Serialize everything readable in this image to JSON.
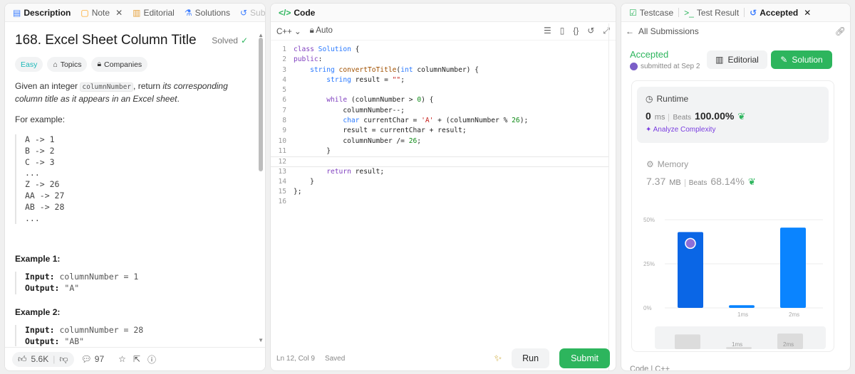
{
  "left": {
    "tabs": [
      {
        "label": "Description",
        "icon": "doc-icon"
      },
      {
        "label": "Note",
        "icon": "note-icon"
      },
      {
        "label": "Editorial",
        "icon": "book-icon"
      },
      {
        "label": "Solutions",
        "icon": "flask-icon"
      },
      {
        "label": "Sub",
        "icon": "history-icon"
      }
    ],
    "title": "168. Excel Sheet Column Title",
    "solved": "Solved",
    "tags": {
      "easy": "Easy",
      "topics": "Topics",
      "companies": "Companies"
    },
    "intro": {
      "a": "Given an integer ",
      "code": "columnNumber",
      "b": ", return ",
      "c": "its corresponding column title as it appears in an Excel sheet",
      "d": "."
    },
    "for_example": "For example:",
    "mapping": [
      "A -> 1",
      "B -> 2",
      "C -> 3",
      "...",
      "Z -> 26",
      "AA -> 27",
      "AB -> 28",
      "..."
    ],
    "example1": {
      "title": "Example 1:",
      "input_label": "Input:",
      "input": " columnNumber = 1",
      "output_label": "Output:",
      "output": " \"A\""
    },
    "example2": {
      "title": "Example 2:",
      "input_label": "Input:",
      "input": " columnNumber = 28",
      "output_label": "Output:",
      "output": " \"AB\""
    },
    "footer": {
      "likes": "5.6K",
      "comments": "97"
    }
  },
  "mid": {
    "tab": "Code",
    "lang": "C++",
    "mode": "Auto",
    "status": {
      "pos": "Ln 12, Col 9",
      "saved": "Saved"
    },
    "run": "Run",
    "submit": "Submit",
    "lines": [
      "class Solution {",
      "public:",
      "    string convertToTitle(int columnNumber) {",
      "        string result = \"\";",
      "",
      "        while (columnNumber > 0) {",
      "            columnNumber--;",
      "            char currentChar = 'A' + (columnNumber % 26);",
      "            result = currentChar + result;",
      "            columnNumber /= 26;",
      "        }",
      "",
      "        return result;",
      "    }",
      "};",
      ""
    ]
  },
  "right": {
    "tabs": [
      {
        "label": "Testcase",
        "icon": "check-box-icon"
      },
      {
        "label": "Test Result",
        "icon": "terminal-icon"
      },
      {
        "label": "Accepted",
        "icon": "history-icon"
      }
    ],
    "back": "All Submissions",
    "status": "Accepted",
    "submitted": "submitted at Sep 2",
    "editorial_btn": "Editorial",
    "solution_btn": "Solution",
    "runtime": {
      "label": "Runtime",
      "value": "0",
      "unit": "ms",
      "beats_label": "Beats",
      "beats": "100.00%",
      "analyze": "Analyze Complexity"
    },
    "memory": {
      "label": "Memory",
      "value": "7.37",
      "unit": "MB",
      "beats_label": "Beats",
      "beats": "68.14%"
    },
    "code_footer": "Code | C++"
  },
  "chart_data": {
    "type": "bar",
    "ytick_labels": [
      "50%",
      "25%",
      "0%"
    ],
    "yticks": [
      50,
      25,
      0
    ],
    "ylim": [
      0,
      50
    ],
    "x_labels": [
      "1ms",
      "2ms"
    ],
    "bars": [
      {
        "x": 0,
        "value": 43.0,
        "highlight": true
      },
      {
        "x": 1,
        "value": 1.5,
        "highlight": false
      },
      {
        "x": 2,
        "value": 45.5,
        "highlight": false
      }
    ],
    "accent": "#0a84ff",
    "highlight_color": "#0a66e6"
  }
}
